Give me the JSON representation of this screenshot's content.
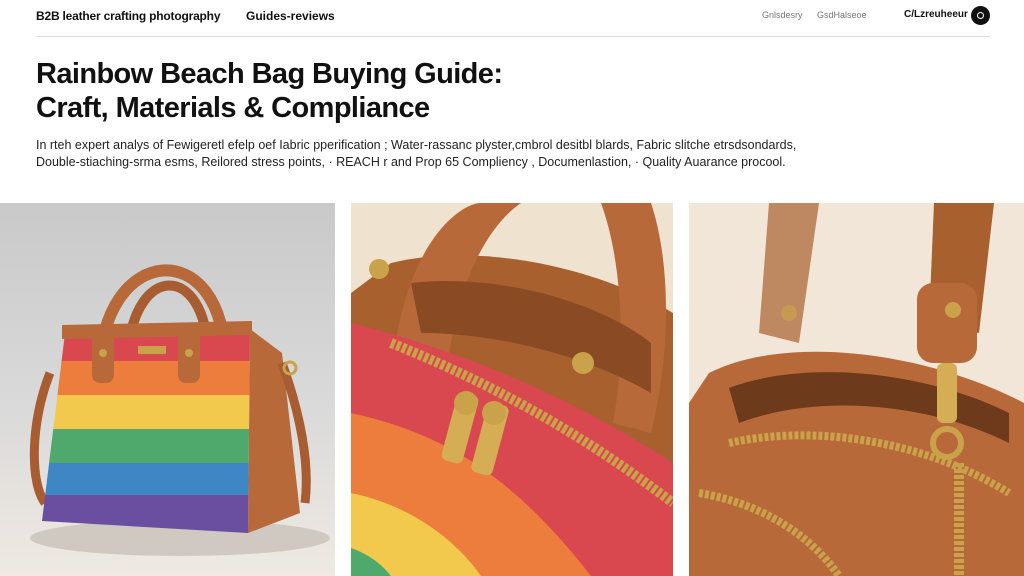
{
  "header": {
    "brand": "B2B leather crafting  photography",
    "nav_link": "Guides-reviews",
    "util_links": [
      "Gnlsdesry",
      "GsdHalseoe"
    ],
    "contact_label": "C/Lzreuheeur"
  },
  "main": {
    "title_line1": "Rainbow Beach Bag Buying Guide:",
    "title_line2": "Craft, Materials & Compliance",
    "summary_line1": "In rteh expert analys of Fewigeretl efelp oef Iabric pperification ; Water-rassanc plyster,cmbrol desitbl blards, Fabric slitche etrsdsondards,",
    "summary_line2": "Double-stiaching-srma esms, Reilored stress points, · REACH r and Prop 65 Compliency , Documenlastion, · Quality Auarance procool."
  },
  "gallery": [
    {
      "subject": "rainbow-striped leather handbag, full view"
    },
    {
      "subject": "close-up of zipper pulls and leather handle"
    },
    {
      "subject": "close-up of shoulder strap hardware and interior"
    }
  ],
  "colors": {
    "rainbow": [
      "#d9474f",
      "#ec7d3c",
      "#f2c94c",
      "#4fa96c",
      "#3f86c4",
      "#6a4fa1"
    ],
    "leather": "#b8693a",
    "hardware": "#c9a24a"
  }
}
